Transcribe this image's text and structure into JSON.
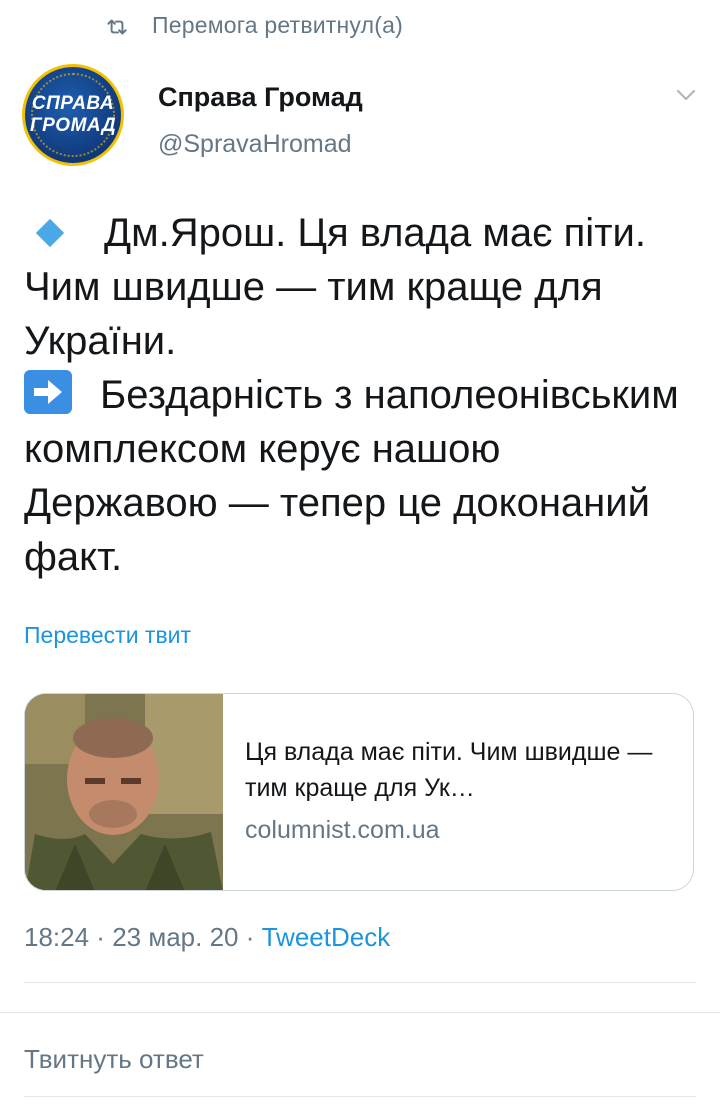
{
  "retweet": {
    "icon": "retweet-icon",
    "text": "Перемога ретвитнул(а)"
  },
  "author": {
    "avatar_text_line1": "СПРАВА",
    "avatar_text_line2": "ГРОМАД",
    "name": "Справа Громад",
    "handle": "@SpravaHromad"
  },
  "tweet": {
    "line1_text": "Дм.Ярош. Ця влада має піти. Чим швидше — тим краще для України.",
    "line2_text": "Бездарність з наполеонівським комплексом керує нашою Державою — тепер це доконаний факт.",
    "translate_label": "Перевести твит"
  },
  "card": {
    "title": "Ця влада має піти. Чим швидше — тим краще для Ук…",
    "domain": "columnist.com.ua"
  },
  "meta": {
    "time": "18:24",
    "date": "23 мар. 20",
    "source": "TweetDeck"
  },
  "reply": {
    "placeholder": "Твитнуть ответ"
  },
  "colors": {
    "link": "#1b95e0",
    "muted": "#657786",
    "divider": "#e1e8ed"
  }
}
